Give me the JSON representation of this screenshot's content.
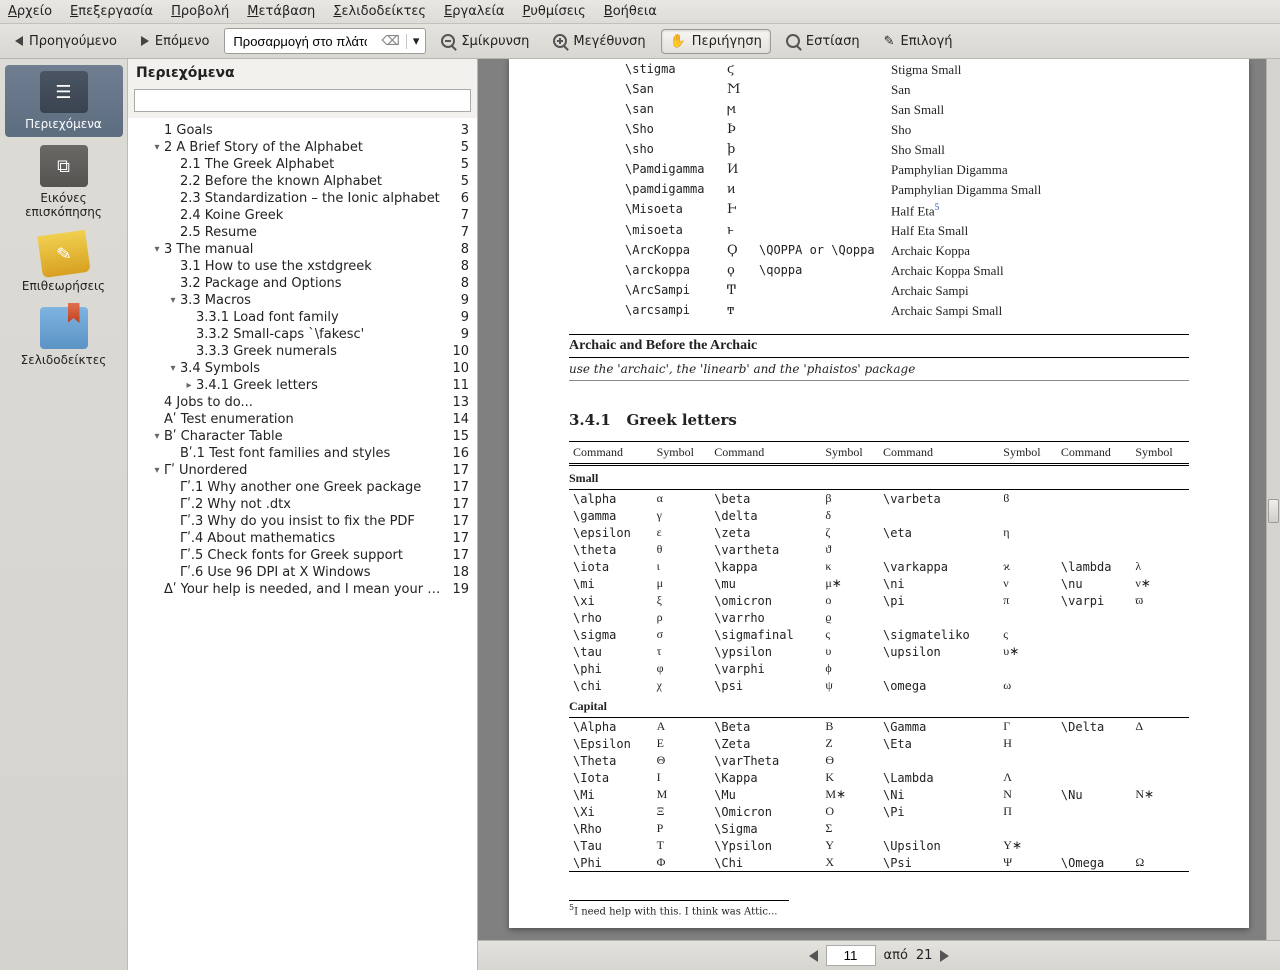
{
  "menu": [
    "Αρχείο",
    "Επεξεργασία",
    "Προβολή",
    "Μετάβαση",
    "Σελιδοδείκτες",
    "Εργαλεία",
    "Ρυθμίσεις",
    "Βοήθεια"
  ],
  "toolbar": {
    "prev": "Προηγούμενο",
    "next": "Επόμενο",
    "zoom_mode": "Προσαρμογή στο πλάτος",
    "zoom_out": "Σμίκρυνση",
    "zoom_in": "Μεγέθυνση",
    "browse": "Περιήγηση",
    "focus": "Εστίαση",
    "select": "Επιλογή"
  },
  "sidebar": {
    "contents": "Περιεχόμενα",
    "thumbnails": "Εικόνες επισκόπησης",
    "reviews": "Επιθεωρήσεις",
    "bookmarks": "Σελιδοδείκτες"
  },
  "toc_title": "Περιεχόμενα",
  "toc": [
    {
      "l": "1 Goals",
      "p": 3,
      "i": 1,
      "e": ""
    },
    {
      "l": "2 A Brief Story of the Alphabet",
      "p": 5,
      "i": 1,
      "e": "▾"
    },
    {
      "l": "2.1 The Greek Alphabet",
      "p": 5,
      "i": 2,
      "e": ""
    },
    {
      "l": "2.2 Before the known Alphabet",
      "p": 5,
      "i": 2,
      "e": ""
    },
    {
      "l": "2.3 Standardization – the Ionic alphabet",
      "p": 6,
      "i": 2,
      "e": ""
    },
    {
      "l": "2.4 Koine Greek",
      "p": 7,
      "i": 2,
      "e": ""
    },
    {
      "l": "2.5 Resume",
      "p": 7,
      "i": 2,
      "e": ""
    },
    {
      "l": "3 The manual",
      "p": 8,
      "i": 1,
      "e": "▾"
    },
    {
      "l": "3.1 How to use the xstdgreek",
      "p": 8,
      "i": 2,
      "e": ""
    },
    {
      "l": "3.2 Package and Options",
      "p": 8,
      "i": 2,
      "e": ""
    },
    {
      "l": "3.3 Macros",
      "p": 9,
      "i": 2,
      "e": "▾"
    },
    {
      "l": "3.3.1 Load font family",
      "p": 9,
      "i": 3,
      "e": ""
    },
    {
      "l": "3.3.2 Small-caps `\\fakesc'",
      "p": 9,
      "i": 3,
      "e": ""
    },
    {
      "l": "3.3.3 Greek numerals",
      "p": 10,
      "i": 3,
      "e": ""
    },
    {
      "l": "3.4 Symbols",
      "p": 10,
      "i": 2,
      "e": "▾"
    },
    {
      "l": "3.4.1 Greek letters",
      "p": 11,
      "i": 3,
      "e": "▸"
    },
    {
      "l": "4 Jobs to do...",
      "p": 13,
      "i": 1,
      "e": ""
    },
    {
      "l": "Αʹ Test enumeration",
      "p": 14,
      "i": 1,
      "e": ""
    },
    {
      "l": "Βʹ Character Table",
      "p": 15,
      "i": 1,
      "e": "▾"
    },
    {
      "l": "Βʹ.1 Test font families and styles",
      "p": 16,
      "i": 2,
      "e": ""
    },
    {
      "l": "Γʹ Unordered",
      "p": 17,
      "i": 1,
      "e": "▾"
    },
    {
      "l": "Γʹ.1 Why another one Greek package",
      "p": 17,
      "i": 2,
      "e": ""
    },
    {
      "l": "Γʹ.2 Why not .dtx",
      "p": 17,
      "i": 2,
      "e": ""
    },
    {
      "l": "Γʹ.3 Why do you insist to fix the PDF",
      "p": 17,
      "i": 2,
      "e": ""
    },
    {
      "l": "Γʹ.4 About mathematics",
      "p": 17,
      "i": 2,
      "e": ""
    },
    {
      "l": "Γʹ.5 Check fonts for Greek support",
      "p": 17,
      "i": 2,
      "e": ""
    },
    {
      "l": "Γʹ.6 Use 96 DPI at X Windows",
      "p": 18,
      "i": 2,
      "e": ""
    },
    {
      "l": "Δʹ Your help is needed, and I mean your feedback",
      "p": 19,
      "i": 1,
      "e": ""
    }
  ],
  "archaic": [
    {
      "c": "\\stigma",
      "s": "ϛ",
      "a": "",
      "d": "Stigma Small"
    },
    {
      "c": "\\San",
      "s": "Ϻ",
      "a": "",
      "d": "San"
    },
    {
      "c": "\\san",
      "s": "ϻ",
      "a": "",
      "d": "San Small"
    },
    {
      "c": "\\Sho",
      "s": "Ϸ",
      "a": "",
      "d": "Sho"
    },
    {
      "c": "\\sho",
      "s": "ϸ",
      "a": "",
      "d": "Sho Small"
    },
    {
      "c": "\\Pamdigamma",
      "s": "Ͷ",
      "a": "",
      "d": "Pamphylian Digamma"
    },
    {
      "c": "\\pamdigamma",
      "s": "ͷ",
      "a": "",
      "d": "Pamphylian Digamma Small"
    },
    {
      "c": "\\Misoeta",
      "s": "Ͱ",
      "a": "",
      "d": "Half Eta",
      "fn": "5"
    },
    {
      "c": "\\misoeta",
      "s": "ͱ",
      "a": "",
      "d": "Half Eta Small"
    },
    {
      "c": "\\ArcKoppa",
      "s": "Ϙ",
      "a": "\\QOPPA or \\Qoppa",
      "d": "Archaic Koppa"
    },
    {
      "c": "\\arckoppa",
      "s": "ϙ",
      "a": "\\qoppa",
      "d": "Archaic Koppa Small"
    },
    {
      "c": "\\ArcSampi",
      "s": "Ͳ",
      "a": "",
      "d": "Archaic Sampi"
    },
    {
      "c": "\\arcsampi",
      "s": "ͳ",
      "a": "",
      "d": "Archaic Sampi Small"
    }
  ],
  "archaic_head": "Archaic and Before the Archaic",
  "archaic_note": "use the 'archaic', the 'linearb' and the 'phaistos' package",
  "h341_no": "3.4.1",
  "h341_t": "Greek letters",
  "gl_headers": [
    "Command",
    "Symbol",
    "Command",
    "Symbol",
    "Command",
    "Symbol",
    "Command",
    "Symbol"
  ],
  "small_label": "Small",
  "small": [
    [
      "\\alpha",
      "α",
      "\\beta",
      "β",
      "\\varbeta",
      "ϐ",
      "",
      ""
    ],
    [
      "\\gamma",
      "γ",
      "\\delta",
      "δ",
      "",
      "",
      "",
      ""
    ],
    [
      "\\epsilon",
      "ε",
      "\\zeta",
      "ζ",
      "\\eta",
      "η",
      "",
      ""
    ],
    [
      "\\theta",
      "θ",
      "\\vartheta",
      "ϑ",
      "",
      "",
      "",
      ""
    ],
    [
      "\\iota",
      "ι",
      "\\kappa",
      "κ",
      "\\varkappa",
      "ϰ",
      "\\lambda",
      "λ"
    ],
    [
      "\\mi",
      "μ",
      "\\mu",
      "μ∗",
      "\\ni",
      "ν",
      "\\nu",
      "ν∗"
    ],
    [
      "\\xi",
      "ξ",
      "\\omicron",
      "ο",
      "\\pi",
      "π",
      "\\varpi",
      "ϖ"
    ],
    [
      "\\rho",
      "ρ",
      "\\varrho",
      "ϱ",
      "",
      "",
      "",
      ""
    ],
    [
      "\\sigma",
      "σ",
      "\\sigmafinal",
      "ς",
      "\\sigmateliko",
      "ς",
      "",
      ""
    ],
    [
      "\\tau",
      "τ",
      "\\ypsilon",
      "υ",
      "\\upsilon",
      "υ∗",
      "",
      ""
    ],
    [
      "\\phi",
      "φ",
      "\\varphi",
      "ϕ",
      "",
      "",
      "",
      ""
    ],
    [
      "\\chi",
      "χ",
      "\\psi",
      "ψ",
      "\\omega",
      "ω",
      "",
      ""
    ]
  ],
  "capital_label": "Capital",
  "capital": [
    [
      "\\Alpha",
      "Α",
      "\\Beta",
      "Β",
      "\\Gamma",
      "Γ",
      "\\Delta",
      "Δ"
    ],
    [
      "\\Epsilon",
      "Ε",
      "\\Zeta",
      "Ζ",
      "\\Eta",
      "Η",
      "",
      ""
    ],
    [
      "\\Theta",
      "Θ",
      "\\varTheta",
      "ϴ",
      "",
      "",
      "",
      ""
    ],
    [
      "\\Iota",
      "Ι",
      "\\Kappa",
      "Κ",
      "\\Lambda",
      "Λ",
      "",
      ""
    ],
    [
      "\\Mi",
      "Μ",
      "\\Mu",
      "Μ∗",
      "\\Ni",
      "Ν",
      "\\Nu",
      "Ν∗"
    ],
    [
      "\\Xi",
      "Ξ",
      "\\Omicron",
      "Ο",
      "\\Pi",
      "Π",
      "",
      ""
    ],
    [
      "\\Rho",
      "Ρ",
      "\\Sigma",
      "Σ",
      "",
      "",
      "",
      ""
    ],
    [
      "\\Tau",
      "Τ",
      "\\Ypsilon",
      "Υ",
      "\\Upsilon",
      "Υ∗",
      "",
      ""
    ],
    [
      "\\Phi",
      "Φ",
      "\\Chi",
      "Χ",
      "\\Psi",
      "Ψ",
      "\\Omega",
      "Ω"
    ]
  ],
  "footnote_no": "5",
  "footnote_txt": "I need help with this. I think was Attic...",
  "page_cur": "11",
  "page_tot": "21",
  "status_of": "από",
  "status_page_input": "11"
}
